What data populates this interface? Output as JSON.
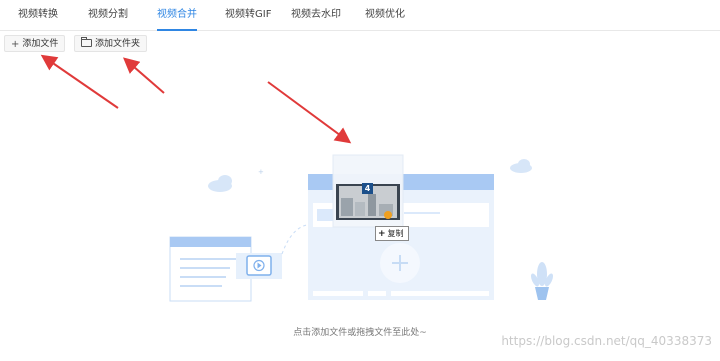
{
  "tabs": [
    {
      "label": "视频转换"
    },
    {
      "label": "视频分割"
    },
    {
      "label": "视频合并"
    },
    {
      "label": "视频转GIF"
    },
    {
      "label": "视频去水印"
    },
    {
      "label": "视频优化"
    }
  ],
  "active_tab": "视频合并",
  "toolbar": {
    "add_file_label": "添加文件",
    "add_folder_label": "添加文件夹"
  },
  "drop_area": {
    "drag_count": "4",
    "copy_label": "复制",
    "hint": "点击添加文件或拖拽文件至此处~"
  },
  "watermark": "https://blog.csdn.net/qq_40338373",
  "colors": {
    "accent": "#2f86e3",
    "arrow": "#e03a3a",
    "illustration_light": "#dbe9fb",
    "illustration_mid": "#a9c9f3"
  }
}
